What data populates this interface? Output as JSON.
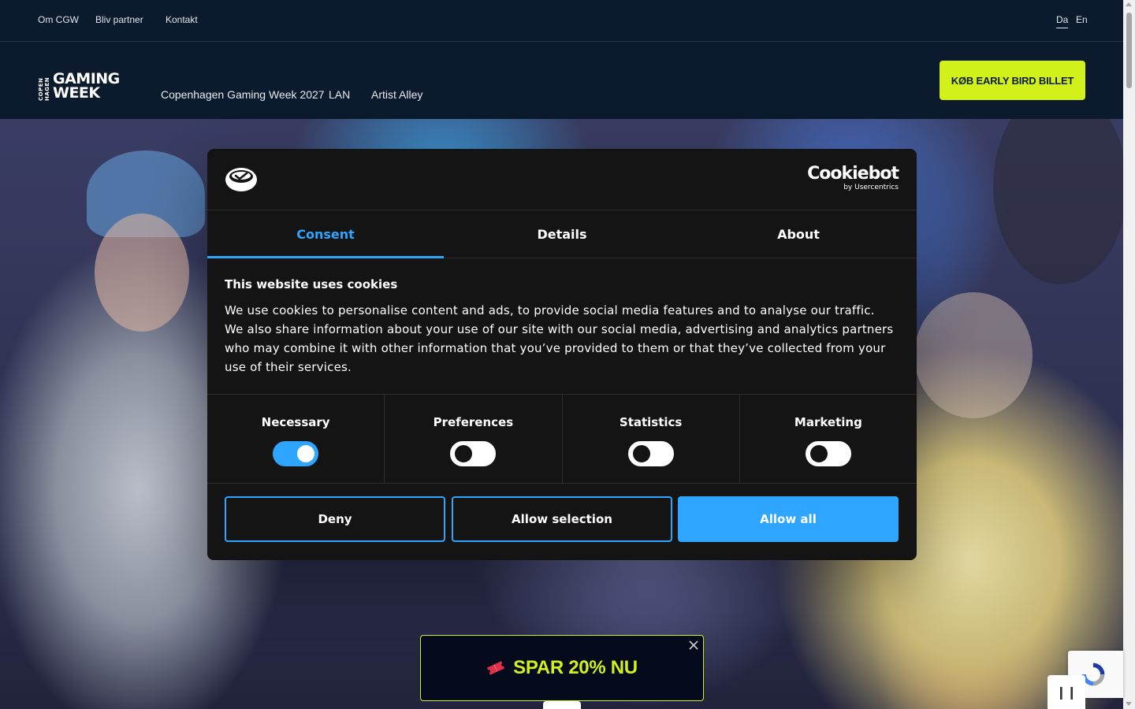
{
  "topbar": {
    "links": [
      "Om CGW",
      "Bliv partner",
      "Kontakt"
    ],
    "languages": [
      "Da",
      "En"
    ],
    "active_language": "Da"
  },
  "header": {
    "logo": {
      "side": "COPEN HAGEN",
      "line1": "GAMING",
      "line2": "WEEK"
    },
    "nav": [
      "Copenhagen Gaming Week 2027",
      "LAN",
      "Artist Alley"
    ],
    "cta_label": "KØB EARLY BIRD BILLET"
  },
  "cookie_dialog": {
    "brand": {
      "name": "Cookiebot",
      "sub": "by Usercentrics"
    },
    "tabs": [
      "Consent",
      "Details",
      "About"
    ],
    "active_tab": "Consent",
    "title": "This website uses cookies",
    "body": "We use cookies to personalise content and ads, to provide social media features and to analyse our traffic. We also share information about your use of our site with our social media, advertising and analytics partners who may combine it with other information that you’ve provided to them or that they’ve collected from your use of their services.",
    "toggles": [
      {
        "label": "Necessary",
        "on": true
      },
      {
        "label": "Preferences",
        "on": false
      },
      {
        "label": "Statistics",
        "on": false
      },
      {
        "label": "Marketing",
        "on": false
      }
    ],
    "buttons": {
      "deny": "Deny",
      "allow_selection": "Allow selection",
      "allow_all": "Allow all"
    }
  },
  "promo": {
    "text": "SPAR 20% NU"
  },
  "colors": {
    "accent": "#d2f01a",
    "cookie_blue": "#2ea6ff",
    "navy": "#0b1a2c"
  }
}
